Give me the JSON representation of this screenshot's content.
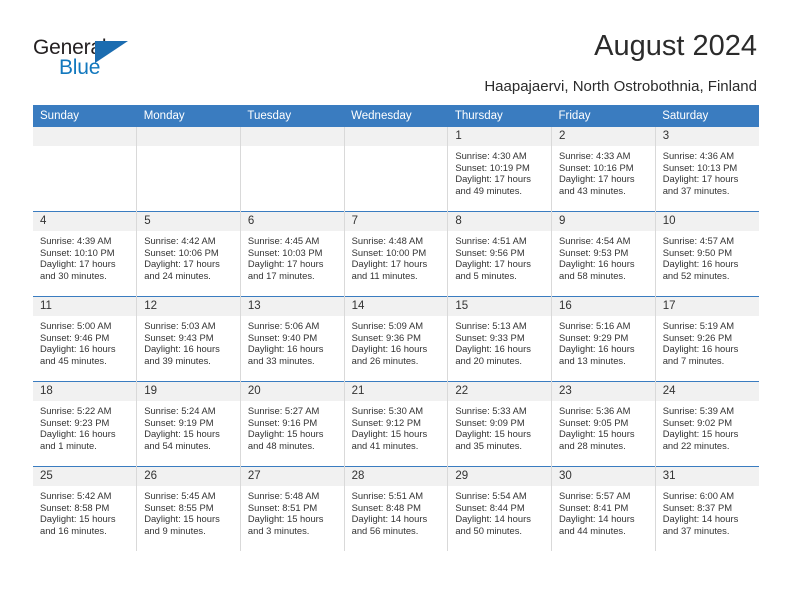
{
  "brand": {
    "name_part1": "General",
    "name_part2": "Blue",
    "triangle_icon": "triangle-icon"
  },
  "header": {
    "title": "August 2024",
    "location": "Haapajaervi, North Ostrobothnia, Finland"
  },
  "colors": {
    "header_blue": "#3a7cc0",
    "brand_blue": "#1278be",
    "daynum_gray": "#f1f1f1",
    "text": "#333333"
  },
  "weekday_headers": [
    "Sunday",
    "Monday",
    "Tuesday",
    "Wednesday",
    "Thursday",
    "Friday",
    "Saturday"
  ],
  "weeks": [
    [
      {
        "day": "",
        "empty": true
      },
      {
        "day": "",
        "empty": true
      },
      {
        "day": "",
        "empty": true
      },
      {
        "day": "",
        "empty": true
      },
      {
        "day": "1",
        "sunrise": "Sunrise: 4:30 AM",
        "sunset": "Sunset: 10:19 PM",
        "daylight1": "Daylight: 17 hours",
        "daylight2": "and 49 minutes."
      },
      {
        "day": "2",
        "sunrise": "Sunrise: 4:33 AM",
        "sunset": "Sunset: 10:16 PM",
        "daylight1": "Daylight: 17 hours",
        "daylight2": "and 43 minutes."
      },
      {
        "day": "3",
        "sunrise": "Sunrise: 4:36 AM",
        "sunset": "Sunset: 10:13 PM",
        "daylight1": "Daylight: 17 hours",
        "daylight2": "and 37 minutes."
      }
    ],
    [
      {
        "day": "4",
        "sunrise": "Sunrise: 4:39 AM",
        "sunset": "Sunset: 10:10 PM",
        "daylight1": "Daylight: 17 hours",
        "daylight2": "and 30 minutes."
      },
      {
        "day": "5",
        "sunrise": "Sunrise: 4:42 AM",
        "sunset": "Sunset: 10:06 PM",
        "daylight1": "Daylight: 17 hours",
        "daylight2": "and 24 minutes."
      },
      {
        "day": "6",
        "sunrise": "Sunrise: 4:45 AM",
        "sunset": "Sunset: 10:03 PM",
        "daylight1": "Daylight: 17 hours",
        "daylight2": "and 17 minutes."
      },
      {
        "day": "7",
        "sunrise": "Sunrise: 4:48 AM",
        "sunset": "Sunset: 10:00 PM",
        "daylight1": "Daylight: 17 hours",
        "daylight2": "and 11 minutes."
      },
      {
        "day": "8",
        "sunrise": "Sunrise: 4:51 AM",
        "sunset": "Sunset: 9:56 PM",
        "daylight1": "Daylight: 17 hours",
        "daylight2": "and 5 minutes."
      },
      {
        "day": "9",
        "sunrise": "Sunrise: 4:54 AM",
        "sunset": "Sunset: 9:53 PM",
        "daylight1": "Daylight: 16 hours",
        "daylight2": "and 58 minutes."
      },
      {
        "day": "10",
        "sunrise": "Sunrise: 4:57 AM",
        "sunset": "Sunset: 9:50 PM",
        "daylight1": "Daylight: 16 hours",
        "daylight2": "and 52 minutes."
      }
    ],
    [
      {
        "day": "11",
        "sunrise": "Sunrise: 5:00 AM",
        "sunset": "Sunset: 9:46 PM",
        "daylight1": "Daylight: 16 hours",
        "daylight2": "and 45 minutes."
      },
      {
        "day": "12",
        "sunrise": "Sunrise: 5:03 AM",
        "sunset": "Sunset: 9:43 PM",
        "daylight1": "Daylight: 16 hours",
        "daylight2": "and 39 minutes."
      },
      {
        "day": "13",
        "sunrise": "Sunrise: 5:06 AM",
        "sunset": "Sunset: 9:40 PM",
        "daylight1": "Daylight: 16 hours",
        "daylight2": "and 33 minutes."
      },
      {
        "day": "14",
        "sunrise": "Sunrise: 5:09 AM",
        "sunset": "Sunset: 9:36 PM",
        "daylight1": "Daylight: 16 hours",
        "daylight2": "and 26 minutes."
      },
      {
        "day": "15",
        "sunrise": "Sunrise: 5:13 AM",
        "sunset": "Sunset: 9:33 PM",
        "daylight1": "Daylight: 16 hours",
        "daylight2": "and 20 minutes."
      },
      {
        "day": "16",
        "sunrise": "Sunrise: 5:16 AM",
        "sunset": "Sunset: 9:29 PM",
        "daylight1": "Daylight: 16 hours",
        "daylight2": "and 13 minutes."
      },
      {
        "day": "17",
        "sunrise": "Sunrise: 5:19 AM",
        "sunset": "Sunset: 9:26 PM",
        "daylight1": "Daylight: 16 hours",
        "daylight2": "and 7 minutes."
      }
    ],
    [
      {
        "day": "18",
        "sunrise": "Sunrise: 5:22 AM",
        "sunset": "Sunset: 9:23 PM",
        "daylight1": "Daylight: 16 hours",
        "daylight2": "and 1 minute."
      },
      {
        "day": "19",
        "sunrise": "Sunrise: 5:24 AM",
        "sunset": "Sunset: 9:19 PM",
        "daylight1": "Daylight: 15 hours",
        "daylight2": "and 54 minutes."
      },
      {
        "day": "20",
        "sunrise": "Sunrise: 5:27 AM",
        "sunset": "Sunset: 9:16 PM",
        "daylight1": "Daylight: 15 hours",
        "daylight2": "and 48 minutes."
      },
      {
        "day": "21",
        "sunrise": "Sunrise: 5:30 AM",
        "sunset": "Sunset: 9:12 PM",
        "daylight1": "Daylight: 15 hours",
        "daylight2": "and 41 minutes."
      },
      {
        "day": "22",
        "sunrise": "Sunrise: 5:33 AM",
        "sunset": "Sunset: 9:09 PM",
        "daylight1": "Daylight: 15 hours",
        "daylight2": "and 35 minutes."
      },
      {
        "day": "23",
        "sunrise": "Sunrise: 5:36 AM",
        "sunset": "Sunset: 9:05 PM",
        "daylight1": "Daylight: 15 hours",
        "daylight2": "and 28 minutes."
      },
      {
        "day": "24",
        "sunrise": "Sunrise: 5:39 AM",
        "sunset": "Sunset: 9:02 PM",
        "daylight1": "Daylight: 15 hours",
        "daylight2": "and 22 minutes."
      }
    ],
    [
      {
        "day": "25",
        "sunrise": "Sunrise: 5:42 AM",
        "sunset": "Sunset: 8:58 PM",
        "daylight1": "Daylight: 15 hours",
        "daylight2": "and 16 minutes."
      },
      {
        "day": "26",
        "sunrise": "Sunrise: 5:45 AM",
        "sunset": "Sunset: 8:55 PM",
        "daylight1": "Daylight: 15 hours",
        "daylight2": "and 9 minutes."
      },
      {
        "day": "27",
        "sunrise": "Sunrise: 5:48 AM",
        "sunset": "Sunset: 8:51 PM",
        "daylight1": "Daylight: 15 hours",
        "daylight2": "and 3 minutes."
      },
      {
        "day": "28",
        "sunrise": "Sunrise: 5:51 AM",
        "sunset": "Sunset: 8:48 PM",
        "daylight1": "Daylight: 14 hours",
        "daylight2": "and 56 minutes."
      },
      {
        "day": "29",
        "sunrise": "Sunrise: 5:54 AM",
        "sunset": "Sunset: 8:44 PM",
        "daylight1": "Daylight: 14 hours",
        "daylight2": "and 50 minutes."
      },
      {
        "day": "30",
        "sunrise": "Sunrise: 5:57 AM",
        "sunset": "Sunset: 8:41 PM",
        "daylight1": "Daylight: 14 hours",
        "daylight2": "and 44 minutes."
      },
      {
        "day": "31",
        "sunrise": "Sunrise: 6:00 AM",
        "sunset": "Sunset: 8:37 PM",
        "daylight1": "Daylight: 14 hours",
        "daylight2": "and 37 minutes."
      }
    ]
  ]
}
